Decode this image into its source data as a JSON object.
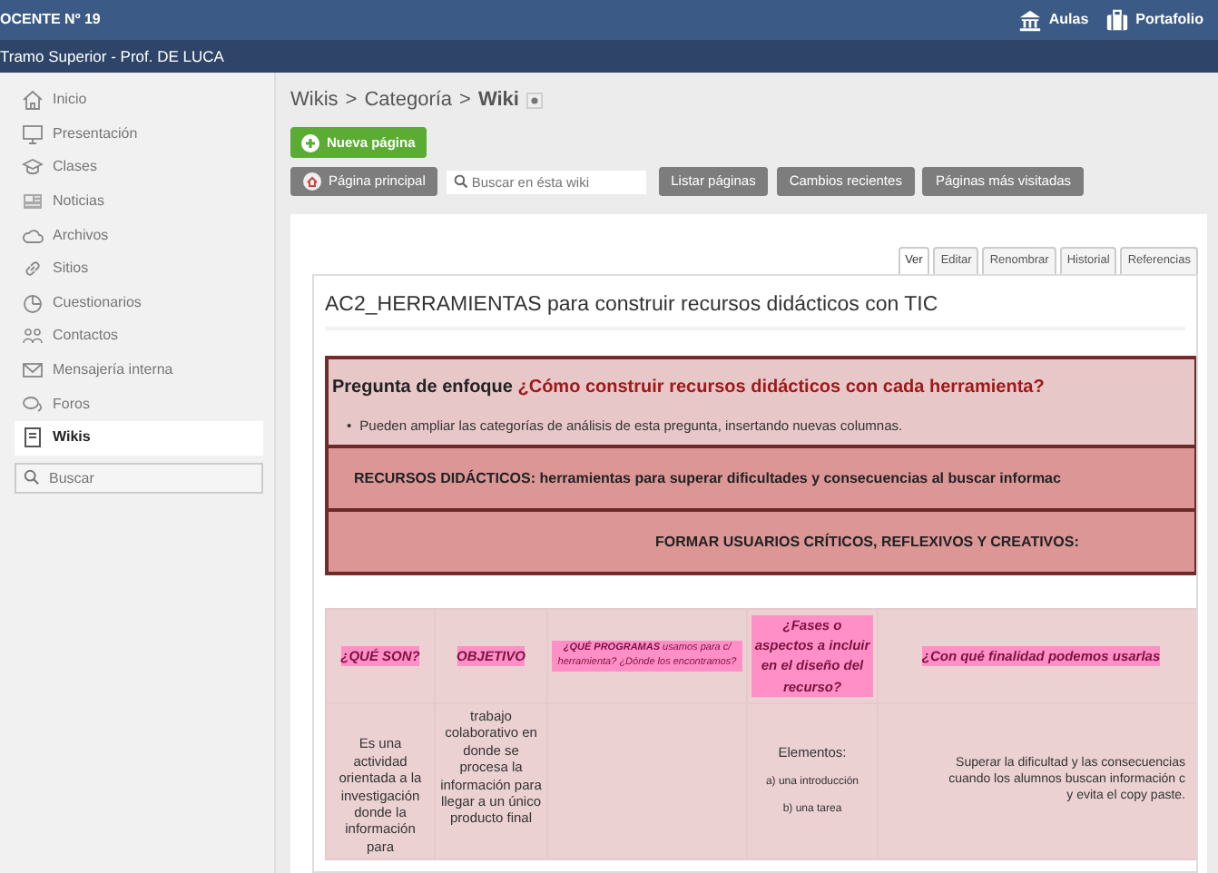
{
  "top_bar": {
    "title": "OCENTE Nº 19",
    "links": [
      {
        "label": "Aulas",
        "kind": "bank"
      },
      {
        "label": "Portafolio",
        "kind": "briefcase"
      }
    ]
  },
  "sub_bar": {
    "title": "Tramo Superior - Prof. DE LUCA"
  },
  "sidebar": {
    "items": [
      {
        "label": "Inicio",
        "selected": false
      },
      {
        "label": "Presentación",
        "selected": false
      },
      {
        "label": "Clases",
        "selected": false
      },
      {
        "label": "Noticias",
        "selected": false
      },
      {
        "label": "Archivos",
        "selected": false
      },
      {
        "label": "Sitios",
        "selected": false
      },
      {
        "label": "Cuestionarios",
        "selected": false
      },
      {
        "label": "Contactos",
        "selected": false
      },
      {
        "label": "Mensajería interna",
        "selected": false
      },
      {
        "label": "Foros",
        "selected": false
      },
      {
        "label": "Wikis",
        "selected": true
      }
    ],
    "search": {
      "placeholder": "Buscar"
    }
  },
  "breadcrumb": [
    {
      "label": "Wikis",
      "current": false
    },
    {
      "separator": ">",
      "label": "Categoría",
      "current": false
    },
    {
      "separator": ">",
      "label": "Wiki",
      "current": true
    }
  ],
  "new_page_button": "Nueva página",
  "toolbar": {
    "main_page_button": "Página principal",
    "search": {
      "placeholder": "Buscar en ésta wiki"
    },
    "buttons": [
      "Listar páginas",
      "Cambios recientes",
      "Páginas más visitadas"
    ]
  },
  "page_tabs": [
    {
      "label": "Ver",
      "selected": true
    },
    {
      "label": "Editar",
      "selected": false
    },
    {
      "label": "Renombrar",
      "selected": false
    },
    {
      "label": "Historial",
      "selected": false
    },
    {
      "label": "Referencias",
      "selected": false
    }
  ],
  "page_title": "AC2_HERRAMIENTAS para construir recursos didácticos con TIC",
  "intro_table": {
    "question_label": "Pregunta de enfoque",
    "question": "¿Cómo construir recursos didácticos con cada herramienta?",
    "note_bullet": "•",
    "note": "Pueden ampliar las categorías de análisis de esta pregunta, insertando nuevas columnas.",
    "banners": [
      "RECURSOS DIDÁCTICOS: herramientas para superar dificultades y consecuencias al buscar informac",
      "FORMAR USUARIOS CRÍTICOS, REFLEXIVOS Y CREATIVOS:"
    ]
  },
  "analysis_table": {
    "columns": [
      "¿QUÉ SON?",
      "OBJETIVO",
      "**¿QUÉ PROGRAMAS** usamos para c/ herramienta? ¿Dónde los encontramos?",
      "¿Fases o aspectos a incluir en el diseño del recurso?",
      "¿Con qué finalidad podemos usarlas"
    ],
    "rows": [
      [
        [
          "Es una actividad orientada a la investigación donde la información para"
        ],
        [
          "trabajo colaborativo en donde se procesa la información para llegar a un único producto final"
        ],
        [],
        [
          "Elementos:",
          "a) una introducción",
          "b) una tarea"
        ],
        [
          "Superar la dificultad y las consecuencias",
          "cuando los alumnos buscan información c",
          "y evita el copy paste."
        ]
      ]
    ]
  }
}
